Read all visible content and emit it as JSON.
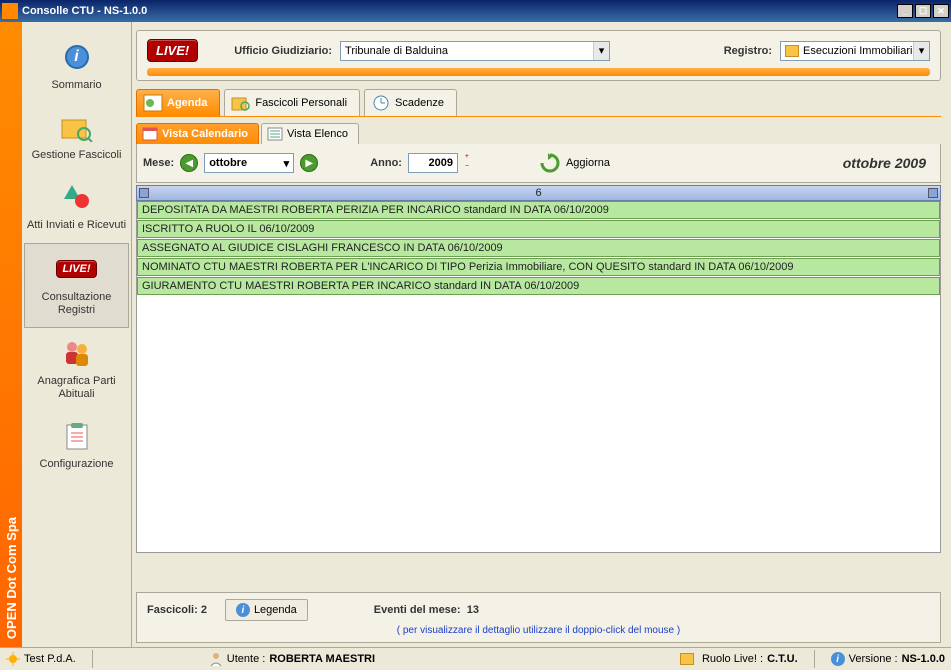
{
  "window": {
    "title": "Consolle CTU - NS-1.0.0"
  },
  "sidebar": {
    "items": [
      {
        "label": "Sommario"
      },
      {
        "label": "Gestione Fascicoli"
      },
      {
        "label": "Atti Inviati e Ricevuti"
      },
      {
        "label": "Consultazione Registri"
      },
      {
        "label": "Anagrafica Parti Abituali"
      },
      {
        "label": "Configurazione"
      }
    ]
  },
  "brand": "OPEN Dot Com Spa",
  "top": {
    "live": "LIVE!",
    "ufficio_label": "Ufficio Giudiziario:",
    "ufficio_value": "Tribunale di Balduina",
    "registro_label": "Registro:",
    "registro_value": "Esecuzioni Immobiliari"
  },
  "tabs": {
    "main": [
      {
        "label": "Agenda"
      },
      {
        "label": "Fascicoli Personali"
      },
      {
        "label": "Scadenze"
      }
    ],
    "sub": [
      {
        "label": "Vista Calendario"
      },
      {
        "label": "Vista Elenco"
      }
    ]
  },
  "filter": {
    "mese_label": "Mese:",
    "mese_value": "ottobre",
    "anno_label": "Anno:",
    "anno_value": "2009",
    "aggiorna": "Aggiorna",
    "title": "ottobre 2009"
  },
  "day_header": "6",
  "events": [
    "DEPOSITATA DA MAESTRI ROBERTA PERIZIA PER INCARICO standard IN DATA 06/10/2009",
    "ISCRITTO A RUOLO IL 06/10/2009",
    "ASSEGNATO AL GIUDICE CISLAGHI FRANCESCO IN DATA 06/10/2009",
    "NOMINATO CTU MAESTRI ROBERTA PER L'INCARICO DI TIPO Perizia Immobiliare, CON QUESITO standard IN DATA 06/10/2009",
    "GIURAMENTO CTU MAESTRI ROBERTA  PER INCARICO standard IN DATA 06/10/2009"
  ],
  "bottom": {
    "fascicoli_label": "Fascicoli:",
    "fascicoli_count": "2",
    "legenda": "Legenda",
    "eventi_label": "Eventi del mese:",
    "eventi_count": "13",
    "hint": "( per visualizzare il dettaglio utilizzare il doppio-click del mouse )"
  },
  "status": {
    "test": "Test P.d.A.",
    "utente_label": "Utente :",
    "utente_value": "ROBERTA MAESTRI",
    "ruolo_label": "Ruolo Live! :",
    "ruolo_value": "C.T.U.",
    "versione_label": "Versione :",
    "versione_value": "NS-1.0.0"
  }
}
